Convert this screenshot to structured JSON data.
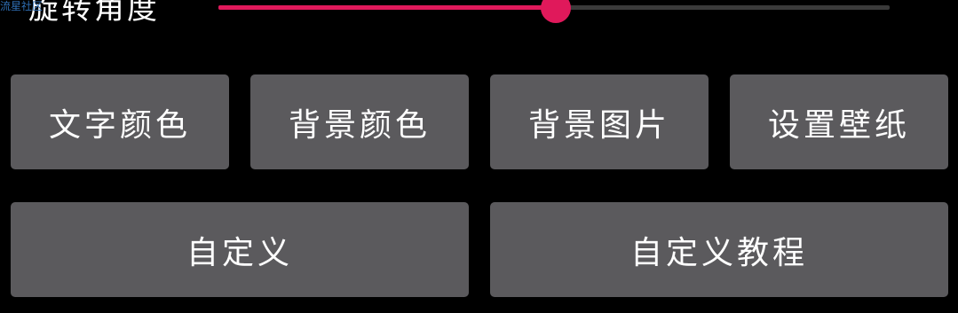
{
  "watermark": "流星社区",
  "slider": {
    "label": "旋转角度",
    "value_percent": 50.3,
    "fill_color": "#e0195b",
    "track_color": "#3a3a3a"
  },
  "buttons": {
    "text_color": "文字颜色",
    "background_color": "背景颜色",
    "background_image": "背景图片",
    "set_wallpaper": "设置壁纸",
    "custom": "自定义",
    "custom_tutorial": "自定义教程"
  },
  "colors": {
    "background": "#000000",
    "button": "#5b5a5d",
    "accent": "#e0195b"
  }
}
